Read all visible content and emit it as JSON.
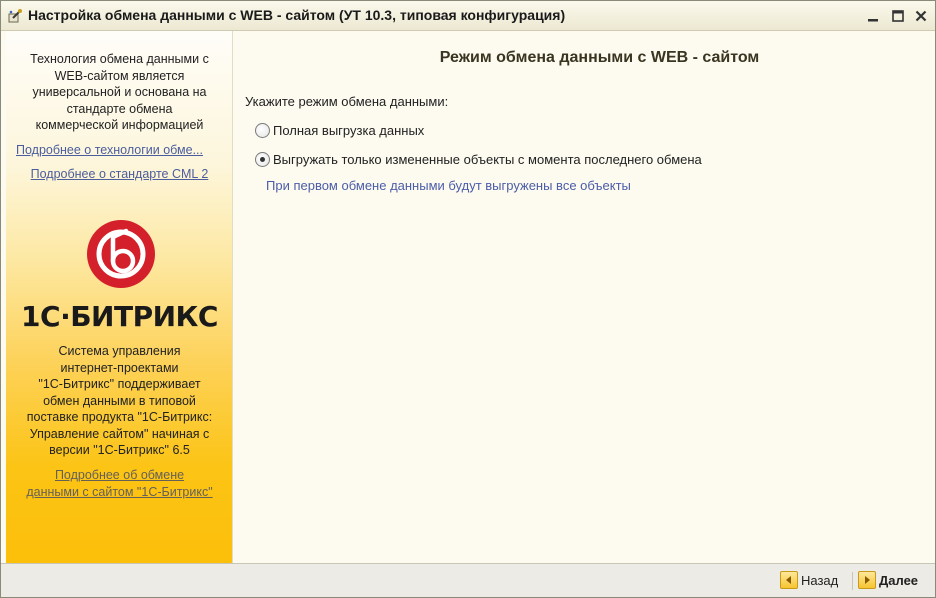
{
  "window": {
    "title": "Настройка обмена данными с WEB - сайтом (УТ 10.3, типовая конфигурация)",
    "icons": {
      "app": "settings-wizard-icon",
      "minimize": "minimize-icon",
      "maximize": "maximize-icon",
      "close": "close-icon"
    }
  },
  "sidebar": {
    "intro_lines": [
      "Технология обмена данными с",
      "WEB-сайтом является",
      "универсальной и основана на",
      "стандарте обмена",
      "коммерческой информацией"
    ],
    "link_technology": "Подробнее о технологии обме...",
    "link_standard": "Подробнее о стандарте CML 2",
    "logo_text": "1С·БИТРИКС",
    "system_lines": [
      "Система управления",
      "интернет-проектами",
      "\"1С-Битрикс\" поддерживает",
      "обмен данными в типовой",
      "поставке продукта \"1С-Битрикс:",
      "Управление сайтом\" начиная с",
      "версии \"1С-Битрикс\" 6.5"
    ],
    "link_bitrix_lines": [
      "Подробнее об обмене",
      "данными с сайтом \"1С-Битрикс\""
    ]
  },
  "main": {
    "heading": "Режим обмена данными с WEB - сайтом",
    "prompt": "Укажите режим обмена данными:",
    "options": [
      {
        "label": "Полная выгрузка данных",
        "selected": false
      },
      {
        "label": "Выгружать только измененные объекты с момента последнего обмена",
        "selected": true
      }
    ],
    "hint": "При первом обмене данными будут выгружены все объекты"
  },
  "footer": {
    "back_label": "Назад",
    "next_label": "Далее"
  },
  "colors": {
    "link": "#4b5d9c",
    "hint": "#4b5da8",
    "accent_yellow": "#fcc415",
    "logo_red": "#d4202a"
  }
}
